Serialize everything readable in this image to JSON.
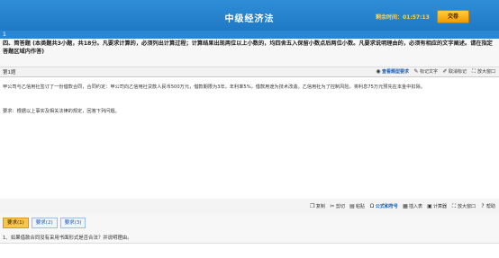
{
  "header": {
    "title": "中级经济法",
    "timer_label": "剩余时间：01:57:13",
    "submit_label": "交卷"
  },
  "question_strip": {
    "number": "1"
  },
  "instructions": "四、简答题 (本类题共3小题，共18分。凡要求计算的，必须列出计算过程；计算结果出现两位以上小数的，均四舍五入保留小数点后两位小数。凡要求说明理由的，必须有相应的文字阐述。请在指定答题区域内作答)",
  "question_bar": {
    "label": "第1题",
    "tools": [
      {
        "name": "view-answer",
        "label": "查看题型要求",
        "icon": "eye-icon"
      },
      {
        "name": "mark",
        "label": "标记文字",
        "icon": "pencil-icon"
      },
      {
        "name": "unmark",
        "label": "取消标记",
        "icon": "eraser-icon"
      },
      {
        "name": "enlarge",
        "label": "放大窗口",
        "icon": "expand-icon"
      }
    ]
  },
  "content": {
    "text": "甲公司与乙信用社签订了一份借款合同，合同约定：甲公司向乙信用社贷款人民币500万元，借款期限为3年，年利率5%，借款用途为技术改造。乙信用社为了控制风险，将利息75万元预先在本金中扣除。",
    "requirement": "要求：根据以上事实及相关法律的规定，回答下列问题。"
  },
  "edit_toolbar": [
    {
      "name": "copy",
      "label": "复制",
      "icon": "copy-icon"
    },
    {
      "name": "cut",
      "label": "剪切",
      "icon": "scissors-icon"
    },
    {
      "name": "paste",
      "label": "粘贴",
      "icon": "paste-icon"
    },
    {
      "name": "formula",
      "label": "公式和符号",
      "icon": "formula-icon"
    },
    {
      "name": "insert-table",
      "label": "插入表",
      "icon": "table-icon"
    },
    {
      "name": "calculator",
      "label": "计算器",
      "icon": "calculator-icon"
    },
    {
      "name": "enlarge",
      "label": "放大窗口",
      "icon": "expand-icon"
    },
    {
      "name": "help",
      "label": "帮助",
      "icon": "help-icon"
    }
  ],
  "tabs": [
    {
      "label": "要求(1)",
      "active": true
    },
    {
      "label": "要求(2)",
      "active": false
    },
    {
      "label": "要求(3)",
      "active": false
    }
  ],
  "subquestion": "1、如果借款合同没有采用书面形式是否合法？并说明理由。"
}
